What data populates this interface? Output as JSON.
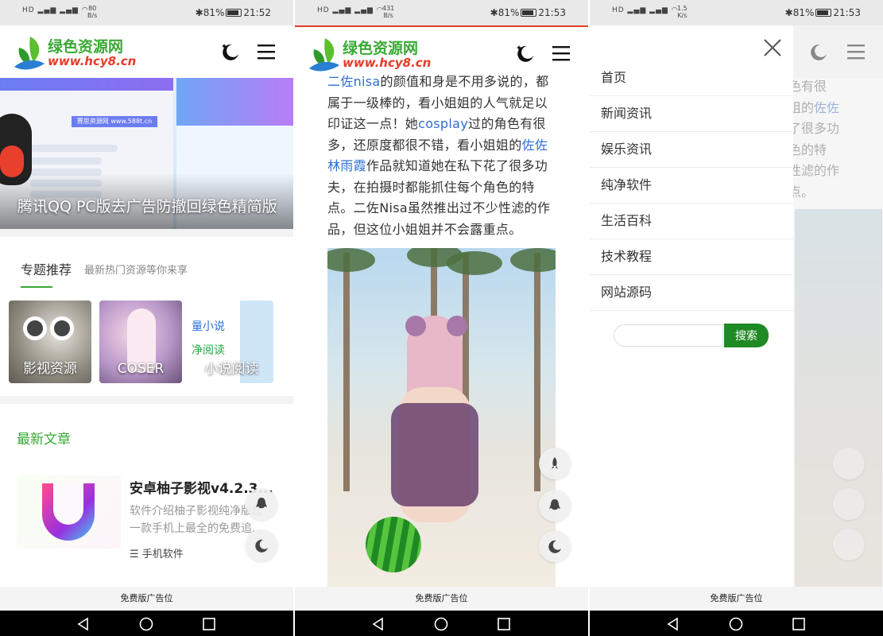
{
  "screens": [
    {
      "status": {
        "net_speed": "80\nB/s",
        "battery": "81%",
        "time": "21:52"
      },
      "header": {
        "site_name": "绿色资源网",
        "site_url": "www.hcy8.cn"
      },
      "banner": {
        "caption": "腾讯QQ PC版去广告防撤回绿色精简版",
        "tag": "赛思资源网 www.588t.cn"
      },
      "topics": {
        "title": "专题推荐",
        "subtitle": "最新热门资源等你来享",
        "cards": [
          {
            "label": "影视资源"
          },
          {
            "label": "COSER"
          },
          {
            "label": "小说阅读",
            "promo_1": "量小说",
            "promo_2": "净阅读"
          }
        ]
      },
      "latest": {
        "title": "最新文章",
        "article": {
          "title": "安卓柚子影视v4.2.3...",
          "desc": "软件介绍柚子影视纯净版是一款手机上最全的免费追...",
          "category": "手机软件"
        }
      },
      "ad_text": "免费版广告位"
    },
    {
      "status": {
        "net_speed": "431\nB/s",
        "battery": "81%",
        "time": "21:53"
      },
      "header": {
        "site_name": "绿色资源网",
        "site_url": "www.hcy8.cn"
      },
      "article": {
        "p1_link": "二佐nisa",
        "p1_a": "的颜值和身是不用多说的，都属于一级棒的，看小姐姐的人气就足以印证这一点！她",
        "p1_link2": "cosplay",
        "p1_b": "过的角色有很多，还原度都很不错，看小姐姐的",
        "p1_link3": "佐佐林雨霞",
        "p1_c": "作品就知道她在私下花了很多功夫，在拍摄时都能抓住每个角色的特点。二佐Nisa虽然推出过不少性滤的作品，但这位小姐姐并不会露重点。"
      },
      "ad_text": "免费版广告位"
    },
    {
      "status": {
        "net_speed": "1.5\nK/s",
        "battery": "81%",
        "time": "21:53"
      },
      "menu": {
        "items": [
          "首页",
          "新闻资讯",
          "娱乐资讯",
          "纯净软件",
          "生活百科",
          "技术教程",
          "网站源码"
        ],
        "search_button": "搜索",
        "search_placeholder": ""
      },
      "behind_text": {
        "line1": "色有很",
        "line2a": "姐的",
        "line2_link": "佐佐",
        "line3": "了很多功",
        "line4": "色的特",
        "line5": "性滤的作",
        "line6": "点。"
      },
      "ad_text": "免费版广告位"
    }
  ],
  "colors": {
    "brand_green": "#3aa935",
    "logo_red": "#e53b2a",
    "link_blue": "#2f6fd6",
    "search_green": "#1f8a24"
  }
}
